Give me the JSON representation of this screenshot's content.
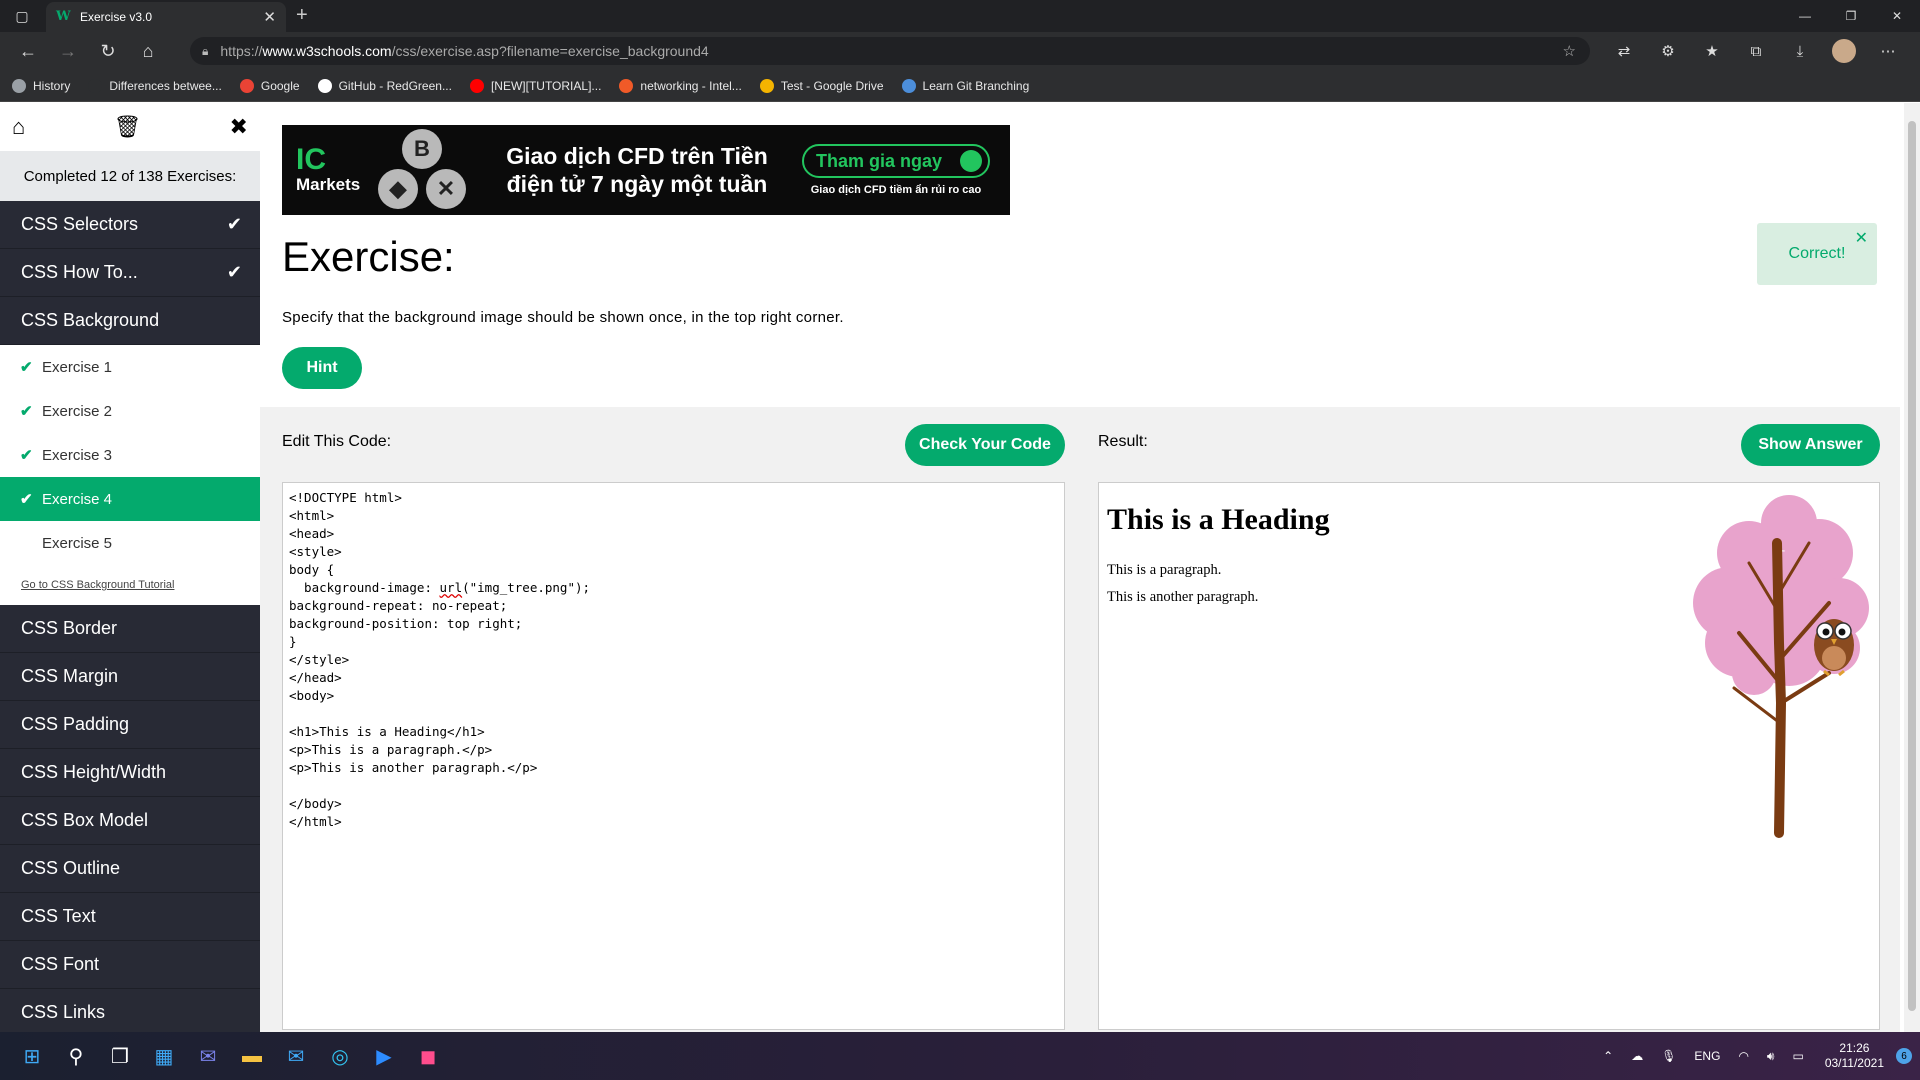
{
  "browser": {
    "tab_title": "Exercise v3.0",
    "tab_favicon": "W",
    "url_prefix": "https://",
    "url_host": "www.w3schools.com",
    "url_path": "/css/exercise.asp?filename=exercise_background4",
    "bookmarks": [
      {
        "label": "History",
        "icon": "history-icon",
        "color": "#9aa0a6"
      },
      {
        "label": "Differences betwee...",
        "icon": "page-icon",
        "color": "#2d2e30"
      },
      {
        "label": "Google",
        "icon": "google-icon",
        "color": "#ea4335"
      },
      {
        "label": "GitHub - RedGreen...",
        "icon": "github-icon",
        "color": "#ffffff"
      },
      {
        "label": "[NEW][TUTORIAL]...",
        "icon": "youtube-icon",
        "color": "#ff0000"
      },
      {
        "label": "networking - Intel...",
        "icon": "ask-icon",
        "color": "#f05a28"
      },
      {
        "label": "Test - Google Drive",
        "icon": "drive-icon",
        "color": "#f4b400"
      },
      {
        "label": "Learn Git Branching",
        "icon": "git-icon",
        "color": "#4c8eda"
      }
    ]
  },
  "sidebar": {
    "progress_text": "Completed 12 of 138 Exercises:",
    "items_top": [
      {
        "label": "CSS Selectors",
        "done": "✔"
      },
      {
        "label": "CSS How To...",
        "done": "✔"
      },
      {
        "label": "CSS Background",
        "done": ""
      }
    ],
    "sub_items": [
      {
        "label": "Exercise 1",
        "tick": "✔"
      },
      {
        "label": "Exercise 2",
        "tick": "✔"
      },
      {
        "label": "Exercise 3",
        "tick": "✔"
      },
      {
        "label": "Exercise 4",
        "tick": "✔"
      },
      {
        "label": "Exercise 5",
        "tick": ""
      }
    ],
    "tutorial_link": "Go to CSS Background Tutorial",
    "items_bottom": [
      {
        "label": "CSS Border"
      },
      {
        "label": "CSS Margin"
      },
      {
        "label": "CSS Padding"
      },
      {
        "label": "CSS Height/Width"
      },
      {
        "label": "CSS Box Model"
      },
      {
        "label": "CSS Outline"
      },
      {
        "label": "CSS Text"
      },
      {
        "label": "CSS Font"
      },
      {
        "label": "CSS Links"
      }
    ]
  },
  "ad": {
    "logo_top": "IC",
    "logo_bottom": "Markets",
    "coin1": "B",
    "coin2": "◆",
    "coin3": "✕",
    "headline_line1": "Giao dịch CFD trên Tiền",
    "headline_line2": "điện tử 7 ngày một tuần",
    "cta": "Tham gia ngay",
    "disclaimer": "Giao dịch CFD tiềm ẩn rủi ro cao"
  },
  "exercise": {
    "title": "Exercise:",
    "instruction": "Specify that the background image should be shown once, in the top right corner.",
    "hint_label": "Hint",
    "toast": "Correct!",
    "edit_label": "Edit This Code:",
    "check_label": "Check Your Code",
    "result_label": "Result:",
    "answer_label": "Show Answer",
    "code_before_url": "<!DOCTYPE html>\n<html>\n<head>\n<style>\nbody {\n  background-image: ",
    "code_url_word": "url",
    "code_after_url": "(\"img_tree.png\");\nbackground-repeat: no-repeat;\nbackground-position: top right;\n}\n</style>\n</head>\n<body>\n\n<h1>This is a Heading</h1>\n<p>This is a paragraph.</p>\n<p>This is another paragraph.</p>\n\n</body>\n</html>",
    "result_heading": "This is a Heading",
    "result_p1": "This is a paragraph.",
    "result_p2": "This is another paragraph."
  },
  "taskbar": {
    "lang": "ENG",
    "time": "21:26",
    "date": "03/11/2021",
    "notifications": "6"
  },
  "colors": {
    "accent": "#04aa6d",
    "sidebar_bg": "#282a35",
    "tree_blossom": "#e8a3cc",
    "tree_trunk": "#7a3b12"
  }
}
